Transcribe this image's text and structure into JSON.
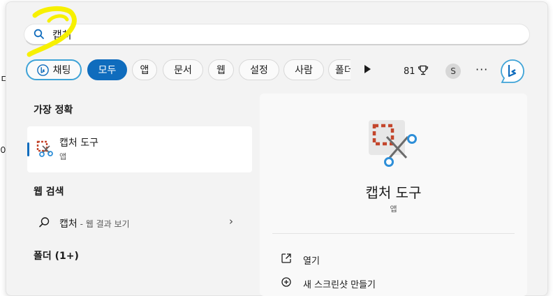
{
  "background": {
    "fragments": [
      "ㄷ",
      "이"
    ]
  },
  "search": {
    "value": "캡처",
    "placeholder": ""
  },
  "filters": [
    {
      "label": "채팅",
      "type": "chat"
    },
    {
      "label": "모두",
      "active": true
    },
    {
      "label": "앱"
    },
    {
      "label": "문서"
    },
    {
      "label": "웹"
    },
    {
      "label": "설정"
    },
    {
      "label": "사람"
    },
    {
      "label": "폴더"
    }
  ],
  "toolbar": {
    "points": "81",
    "avatar_initial": "S",
    "more": "···"
  },
  "best_match": {
    "heading": "가장 정확",
    "title": "캡처 도구",
    "subtitle": "앱"
  },
  "web_search": {
    "heading": "웹 검색",
    "query": "캡처",
    "suffix": " - 웹 결과 보기"
  },
  "folders": {
    "heading": "폴더 (1+)"
  },
  "detail": {
    "name": "캡처 도구",
    "type": "앱",
    "actions": [
      {
        "label": "열기",
        "icon": "open-icon"
      },
      {
        "label": "새 스크린샷 만들기",
        "icon": "new-screenshot-icon"
      }
    ]
  },
  "colors": {
    "accent": "#0f6cbd",
    "chat_outline": "#3ea3d7",
    "highlight": "#f7f000"
  }
}
